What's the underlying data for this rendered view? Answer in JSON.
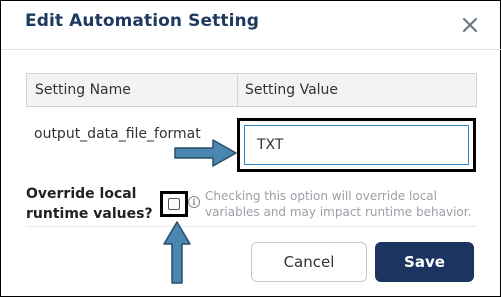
{
  "dialog": {
    "title": "Edit Automation Setting",
    "close_icon": "close-icon"
  },
  "table": {
    "headers": [
      "Setting Name",
      "Setting Value"
    ],
    "row": {
      "name": "output_data_file_format",
      "value": "TXT"
    }
  },
  "override": {
    "label": "Override local runtime values?",
    "checked": false,
    "help_icon": "info-icon",
    "help_text": "Checking this option will override local variables and may impact runtime behavior."
  },
  "buttons": {
    "cancel": "Cancel",
    "save": "Save"
  },
  "colors": {
    "title": "#1f3a60",
    "primary": "#1c3560",
    "input_border": "#2f86c5",
    "annotation_arrow": "#4a86b0",
    "help_text": "#9aa0a6"
  }
}
